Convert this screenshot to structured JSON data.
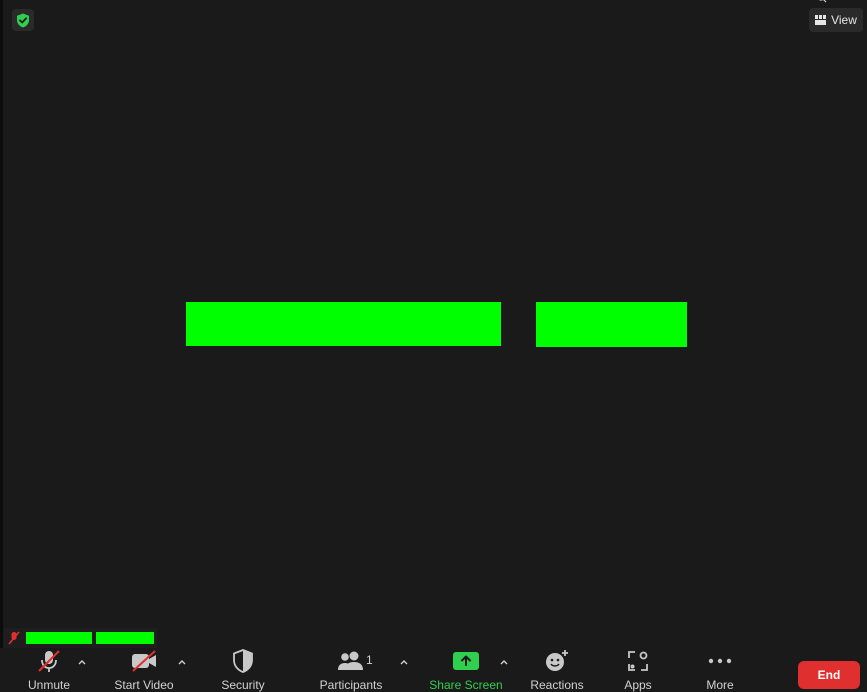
{
  "view_button": {
    "label": "View",
    "icon": "grid-icon"
  },
  "toolbar": {
    "unmute": "Unmute",
    "start_video": "Start Video",
    "security": "Security",
    "participants": "Participants",
    "participants_count": "1",
    "share_screen": "Share Screen",
    "reactions": "Reactions",
    "apps": "Apps",
    "more": "More",
    "end": "End"
  },
  "colors": {
    "background": "#1a1a1a",
    "share_green": "#2fd04e",
    "end_red": "#e02f2f",
    "muted_red": "#e02f2f",
    "redaction": "#00ff00"
  }
}
